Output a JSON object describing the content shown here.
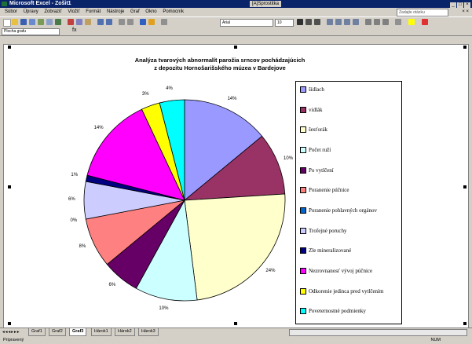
{
  "window": {
    "title": "Microsoft Excel - Zošit1",
    "task_button": "[A]Sprostitka"
  },
  "menu": {
    "items": [
      "Súbor",
      "Úpravy",
      "Zobraziť",
      "Vložiť",
      "Formát",
      "Nástroje",
      "Graf",
      "Okno",
      "Pomocník"
    ],
    "help_placeholder": "Zadajte otázku",
    "close_glyph": "× ×"
  },
  "toolbar": {
    "font": "Arial",
    "size": "10"
  },
  "namebox": {
    "value": "Plocha grafu"
  },
  "formula": {
    "fx": "fx"
  },
  "chart_data": {
    "type": "pie",
    "title": "Analýza tvarových abnormalít parožia srncov pochádzajúcich z depozitu Hornošarišského múzea v Bardejove",
    "title_lines": [
      "Analýza tvarových abnormalít parožia srncov pochádzajúcich",
      "z depozitu Hornošarišského múzea v Bardejove"
    ],
    "categories": [
      "šídlach",
      "vidlák",
      "šesťorák",
      "Počet ruží",
      "Po vytlčení",
      "Poranenie púčnice",
      "Poranenie pohlavných orgánov",
      "Trofejné poruchy",
      "Zle mineralizované",
      "Nezrovnanosť vývoj púčnice",
      "Odkorenie jedinca pred vytlčením",
      "Poveternostné podmienky"
    ],
    "values": [
      14,
      10,
      24,
      10,
      6,
      8,
      0,
      6,
      1,
      14,
      3,
      4
    ],
    "value_labels": [
      "14%",
      "10%",
      "24%",
      "10%",
      "6%",
      "8%",
      "0%",
      "6%",
      "1%",
      "14%",
      "3%",
      "4%"
    ],
    "colors": [
      "#9999ff",
      "#993366",
      "#ffffcc",
      "#ccffff",
      "#660066",
      "#ff8080",
      "#0066cc",
      "#ccccff",
      "#000080",
      "#ff00ff",
      "#ffff00",
      "#00ffff"
    ],
    "legend_position": "right"
  },
  "tabs": [
    "Graf1",
    "Graf2",
    "Graf3",
    "Hárok1",
    "Hárok2",
    "Hárok3"
  ],
  "active_tab": "Graf3",
  "tab_nav": "◂◂◂▸▸▸",
  "status": {
    "left": "Pripravený",
    "right": "NUM"
  }
}
